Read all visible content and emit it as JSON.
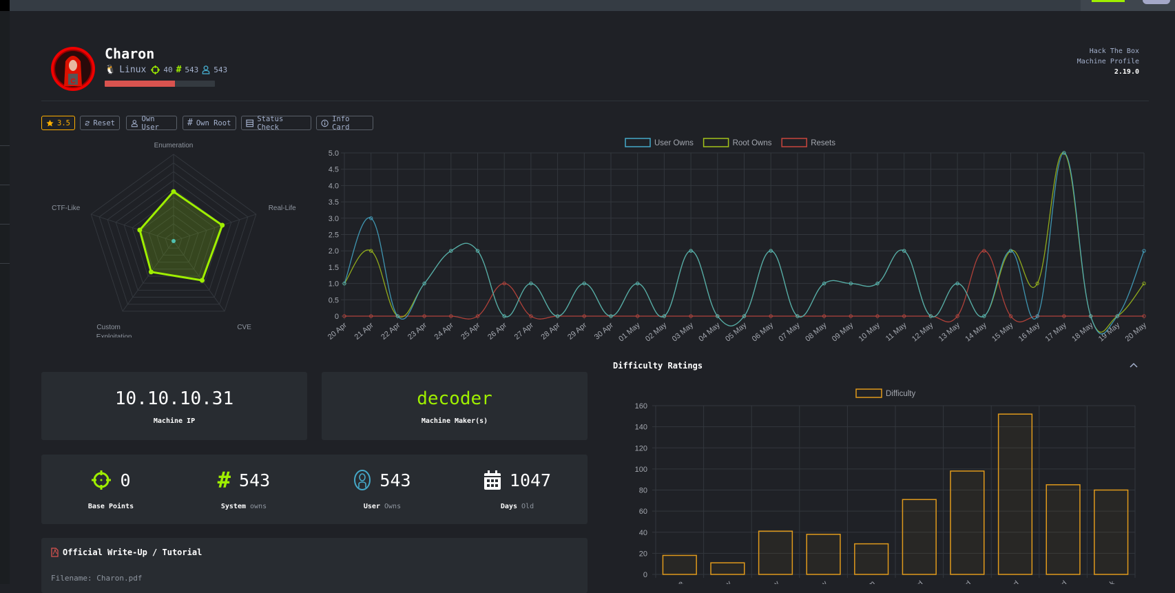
{
  "header": {
    "machine_name": "Charon",
    "os": "Linux",
    "points": "40",
    "system_owns": "543",
    "user_owns": "543",
    "difficulty_progress_percent": 64,
    "brand_line1": "Hack The Box",
    "brand_line2": "Machine Profile",
    "version": "2.19.0"
  },
  "toolbar": {
    "rating": "3.5",
    "reset": "Reset",
    "own_user": "Own User",
    "own_root": "Own Root",
    "status_check": "Status Check",
    "info_card": "Info Card"
  },
  "info": {
    "ip": "10.10.10.31",
    "ip_label": "Machine IP",
    "maker": "decoder",
    "maker_label": "Machine Maker(s)"
  },
  "stats": [
    {
      "value": "0",
      "label": "Base Points",
      "sub": ""
    },
    {
      "value": "543",
      "label": "System",
      "sub": "owns"
    },
    {
      "value": "543",
      "label": "User",
      "sub": "Owns"
    },
    {
      "value": "1047",
      "label": "Days",
      "sub": "Old"
    }
  ],
  "writeup": {
    "title": "Official Write-Up / Tutorial",
    "filename": "Filename: Charon.pdf"
  },
  "difficulty_section": {
    "title": "Difficulty Ratings"
  },
  "colors": {
    "user": "#45a9c9",
    "root": "#a3c21a",
    "resets": "#c9463d",
    "difficulty": "#e09a1c",
    "radar": "#9fef00",
    "accent_green": "#9fef00"
  },
  "chart_data": [
    {
      "type": "radar",
      "labels": [
        "Enumeration",
        "Real-Life",
        "CVE",
        "Custom Exploitation",
        "CTF-Like"
      ],
      "values": [
        5.7,
        5.9,
        5.6,
        4.4,
        4.1
      ],
      "range": [
        0,
        10
      ]
    },
    {
      "type": "line",
      "x": [
        "20 Apr",
        "21 Apr",
        "22 Apr",
        "23 Apr",
        "24 Apr",
        "25 Apr",
        "26 Apr",
        "27 Apr",
        "28 Apr",
        "29 Apr",
        "30 Apr",
        "01 May",
        "02 May",
        "03 May",
        "04 May",
        "05 May",
        "06 May",
        "07 May",
        "08 May",
        "09 May",
        "10 May",
        "11 May",
        "12 May",
        "13 May",
        "14 May",
        "15 May",
        "16 May",
        "17 May",
        "18 May",
        "19 May",
        "20 May"
      ],
      "series": [
        {
          "name": "User Owns",
          "values": [
            1,
            3,
            0,
            1,
            2,
            2,
            0,
            1,
            0,
            1,
            0,
            1,
            0,
            2,
            0,
            0,
            2,
            0,
            1,
            1,
            1,
            2,
            0,
            1,
            0,
            2,
            0,
            5,
            0,
            0,
            2
          ]
        },
        {
          "name": "Root Owns",
          "values": [
            1,
            2,
            0,
            1,
            2,
            2,
            0,
            1,
            0,
            1,
            0,
            1,
            0,
            2,
            0,
            0,
            2,
            0,
            1,
            1,
            1,
            2,
            0,
            1,
            0,
            2,
            1,
            5,
            0,
            0,
            1
          ]
        },
        {
          "name": "Resets",
          "values": [
            0,
            0,
            0,
            0,
            0,
            0,
            1,
            0,
            0,
            0,
            0,
            0,
            0,
            0,
            0,
            0,
            0,
            0,
            0,
            0,
            0,
            0,
            0,
            0,
            2,
            0,
            0,
            0,
            0,
            0,
            0
          ]
        }
      ],
      "yticks": [
        "0",
        "0.5",
        "1.0",
        "1.5",
        "2.0",
        "2.5",
        "3.0",
        "3.5",
        "4.0",
        "4.5",
        "5.0"
      ],
      "ylim": [
        0,
        5
      ],
      "legend": "top",
      "grid": true
    },
    {
      "type": "bar",
      "categories": [
        "Piece of Cake",
        "Very Easy",
        "Easy",
        "Not Too Easy",
        "Medium",
        "A Bit Hard",
        "Hard",
        "Too Hard",
        "Extremely Hard",
        "Brainfuck"
      ],
      "series": [
        {
          "name": "Difficulty",
          "values": [
            18,
            11,
            41,
            38,
            29,
            71,
            98,
            152,
            85,
            80
          ]
        }
      ],
      "yticks": [
        "0",
        "20",
        "40",
        "60",
        "80",
        "100",
        "120",
        "140",
        "160"
      ],
      "ylim": [
        0,
        160
      ],
      "legend": "top",
      "grid": true
    }
  ]
}
